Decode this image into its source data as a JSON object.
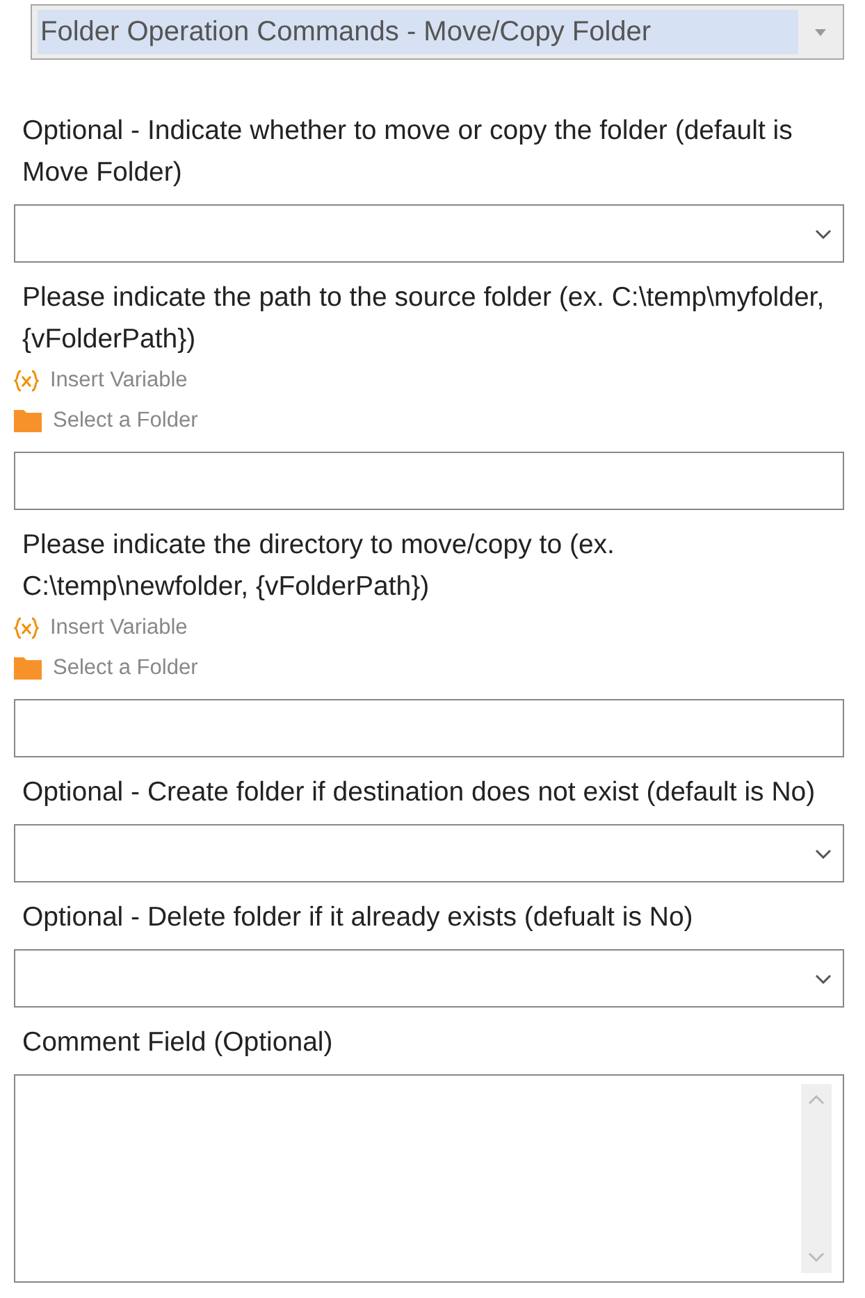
{
  "command_select": {
    "value": "Folder Operation Commands - Move/Copy Folder"
  },
  "fields": [
    {
      "kind": "dropdown",
      "label": "Optional - Indicate whether to move or copy the folder (default is Move Folder)"
    },
    {
      "kind": "path",
      "label": "Please indicate the path to the source folder (ex. C:\\temp\\myfolder, {vFolderPath})",
      "tools": [
        "Insert Variable",
        "Select a Folder"
      ]
    },
    {
      "kind": "path",
      "label": "Please indicate the directory to move/copy to (ex. C:\\temp\\newfolder, {vFolderPath})",
      "tools": [
        "Insert Variable",
        "Select a Folder"
      ]
    },
    {
      "kind": "dropdown",
      "label": "Optional - Create folder if destination does not exist (default is No)"
    },
    {
      "kind": "dropdown",
      "label": "Optional - Delete folder if it already exists (defualt is No)"
    },
    {
      "kind": "textarea",
      "label": "Comment Field (Optional)"
    }
  ]
}
